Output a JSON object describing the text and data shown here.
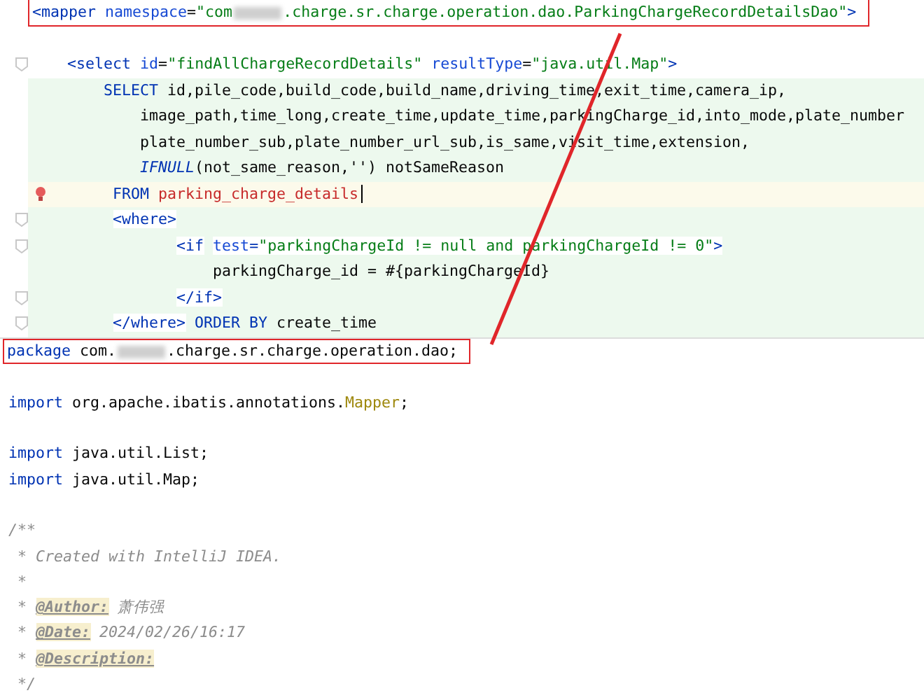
{
  "xml_editor": {
    "lines": [
      {
        "highlighted": false,
        "current": false,
        "boxed": true,
        "fold": false,
        "bulb": false,
        "tokens": [
          {
            "kind": "tag",
            "text": "<mapper"
          },
          {
            "kind": "attr",
            "text": " namespace"
          },
          {
            "kind": "plain",
            "text": "="
          },
          {
            "kind": "string",
            "text": "\"com"
          },
          {
            "kind": "redacted"
          },
          {
            "kind": "string",
            "text": ".charge.sr.charge.operation.dao.ParkingChargeRecordDetailsDao\""
          },
          {
            "kind": "tag",
            "text": ">"
          }
        ]
      },
      {
        "highlighted": false,
        "current": false,
        "boxed": false,
        "fold": false,
        "bulb": false
      },
      {
        "highlighted": false,
        "current": false,
        "boxed": false,
        "fold": true,
        "bulb": false,
        "tokens": [
          {
            "kind": "tag",
            "text": "    <select"
          },
          {
            "kind": "attr",
            "text": " id"
          },
          {
            "kind": "plain",
            "text": "="
          },
          {
            "kind": "string",
            "text": "\"findAllChargeRecordDetails\""
          },
          {
            "kind": "attr",
            "text": " resultType"
          },
          {
            "kind": "plain",
            "text": "="
          },
          {
            "kind": "string",
            "text": "\"java.util.Map\""
          },
          {
            "kind": "tag",
            "text": ">"
          }
        ]
      },
      {
        "highlighted": true,
        "current": false,
        "boxed": false,
        "fold": false,
        "bulb": false,
        "tokens": [
          {
            "kind": "keyword",
            "text": "        SELECT"
          },
          {
            "kind": "plain",
            "text": " id,pile_code,build_code,build_name,driving_time,exit_time,camera_ip,"
          }
        ]
      },
      {
        "highlighted": true,
        "current": false,
        "boxed": false,
        "fold": false,
        "bulb": false,
        "tokens": [
          {
            "kind": "plain",
            "text": "            image_path,time_long,create_time,update_time,parkingCharge_id,into_mode,plate_number"
          }
        ]
      },
      {
        "highlighted": true,
        "current": false,
        "boxed": false,
        "fold": false,
        "bulb": false,
        "tokens": [
          {
            "kind": "plain",
            "text": "            plate_number_sub,plate_number_url_sub,is_same,visit_time,extension,"
          }
        ]
      },
      {
        "highlighted": true,
        "current": false,
        "boxed": false,
        "fold": false,
        "bulb": false,
        "tokens": [
          {
            "kind": "function",
            "text": "            IFNULL"
          },
          {
            "kind": "plain",
            "text": "(not_same_reason,'') notSameReason"
          }
        ]
      },
      {
        "highlighted": false,
        "current": true,
        "boxed": false,
        "fold": false,
        "bulb": true,
        "tokens": [
          {
            "kind": "keyword",
            "text": "         FROM"
          },
          {
            "kind": "table",
            "text": " parking_charge_details"
          }
        ]
      },
      {
        "highlighted": true,
        "current": false,
        "boxed": false,
        "fold": true,
        "bulb": false,
        "tokens": [
          {
            "kind": "tag",
            "text": "         <where>"
          }
        ]
      },
      {
        "highlighted": true,
        "current": false,
        "boxed": false,
        "fold": true,
        "bulb": false,
        "tokens": [
          {
            "kind": "tag",
            "text": "                <if"
          },
          {
            "kind": "attr",
            "text": " test"
          },
          {
            "kind": "tag",
            "text": "="
          },
          {
            "kind": "string",
            "text": "\"parkingChargeId != null and parkingChargeId != 0\""
          },
          {
            "kind": "tag",
            "text": ">"
          }
        ]
      },
      {
        "highlighted": true,
        "current": false,
        "boxed": false,
        "fold": false,
        "bulb": false,
        "tokens": [
          {
            "kind": "plain",
            "text": "                    parkingCharge_id = #{parkingChargeId}"
          }
        ]
      },
      {
        "highlighted": true,
        "current": false,
        "boxed": false,
        "fold": true,
        "bulb": false,
        "tokens": [
          {
            "kind": "tag",
            "text": "                </if>"
          }
        ]
      },
      {
        "highlighted": true,
        "current": false,
        "boxed": false,
        "fold": true,
        "bulb": false,
        "tokens": [
          {
            "kind": "tag",
            "text": "         </where>"
          },
          {
            "kind": "keyword",
            "text": " ORDER BY"
          },
          {
            "kind": "plain",
            "text": " create_time"
          }
        ]
      }
    ]
  },
  "java_editor": {
    "lines": [
      {
        "boxed": true,
        "tokens": [
          {
            "kind": "keyword",
            "text": "package"
          },
          {
            "kind": "plain",
            "text": " com."
          },
          {
            "kind": "redacted"
          },
          {
            "kind": "plain",
            "text": ".charge.sr.charge.operation.dao;"
          }
        ]
      },
      {
        "boxed": false
      },
      {
        "boxed": false,
        "tokens": [
          {
            "kind": "keyword",
            "text": "import"
          },
          {
            "kind": "plain",
            "text": " org.apache.ibatis.annotations."
          },
          {
            "kind": "annotation",
            "text": "Mapper"
          },
          {
            "kind": "plain",
            "text": ";"
          }
        ]
      },
      {
        "boxed": false
      },
      {
        "boxed": false,
        "tokens": [
          {
            "kind": "keyword",
            "text": "import"
          },
          {
            "kind": "plain",
            "text": " java.util.List;"
          }
        ]
      },
      {
        "boxed": false,
        "tokens": [
          {
            "kind": "keyword",
            "text": "import"
          },
          {
            "kind": "plain",
            "text": " java.util.Map;"
          }
        ]
      },
      {
        "boxed": false
      },
      {
        "boxed": false,
        "tokens": [
          {
            "kind": "comment",
            "text": "/**"
          }
        ]
      },
      {
        "boxed": false,
        "tokens": [
          {
            "kind": "comment",
            "text": " * Created with IntelliJ IDEA."
          }
        ]
      },
      {
        "boxed": false,
        "tokens": [
          {
            "kind": "comment",
            "text": " *"
          }
        ]
      },
      {
        "boxed": false,
        "tokens": [
          {
            "kind": "comment",
            "text": " * "
          },
          {
            "kind": "doctag",
            "text": "@Author:"
          },
          {
            "kind": "comment",
            "text": " 萧伟强"
          }
        ]
      },
      {
        "boxed": false,
        "tokens": [
          {
            "kind": "comment",
            "text": " * "
          },
          {
            "kind": "doctag",
            "text": "@Date:"
          },
          {
            "kind": "comment",
            "text": " 2024/02/26/16:17"
          }
        ]
      },
      {
        "boxed": false,
        "tokens": [
          {
            "kind": "comment",
            "text": " * "
          },
          {
            "kind": "doctag",
            "text": "@Description:"
          }
        ]
      },
      {
        "boxed": false,
        "tokens": [
          {
            "kind": "comment",
            "text": " */"
          }
        ]
      }
    ]
  }
}
